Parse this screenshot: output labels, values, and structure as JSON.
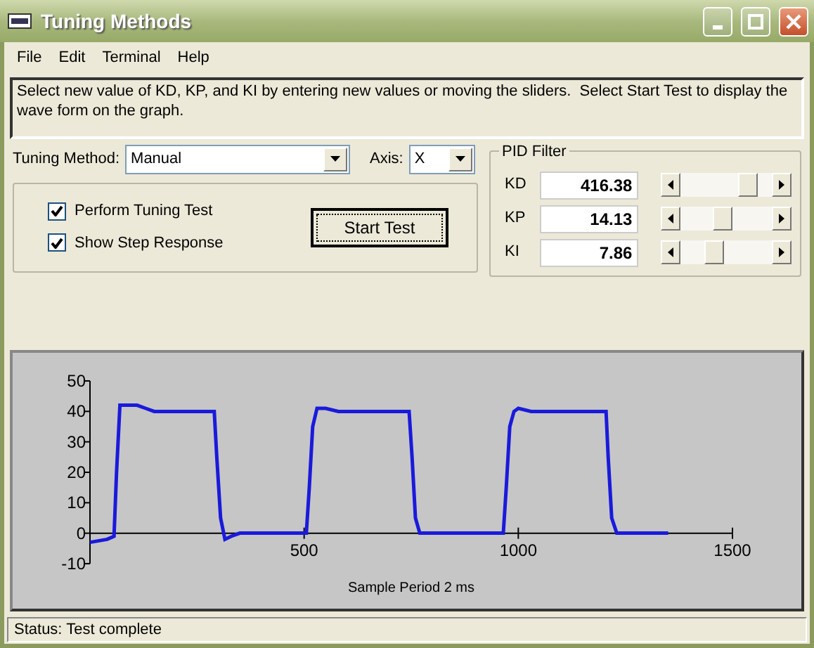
{
  "window": {
    "title": "Tuning Methods"
  },
  "menu": [
    {
      "label": "File"
    },
    {
      "label": "Edit"
    },
    {
      "label": "Terminal"
    },
    {
      "label": "Help"
    }
  ],
  "instructions": "Select new value of KD, KP, and KI by entering new values or moving the sliders.  Select Start Test to display the wave form on the graph.",
  "tuning_method": {
    "label": "Tuning Method:",
    "value": "Manual"
  },
  "axis": {
    "label": "Axis:",
    "value": "X"
  },
  "options": [
    {
      "label": "Perform Tuning Test",
      "checked": true
    },
    {
      "label": "Show Step Response",
      "checked": true
    }
  ],
  "start_button": "Start Test",
  "pid_filter": {
    "title": "PID Filter",
    "params": [
      {
        "label": "KD",
        "value": "416.38",
        "level": 0.8
      },
      {
        "label": "KP",
        "value": "14.13",
        "level": 0.45
      },
      {
        "label": "KI",
        "value": "7.86",
        "level": 0.34
      }
    ]
  },
  "graph": {
    "chart_data": {
      "type": "line",
      "xlabel": "Sample Period 2 ms",
      "xlim": [
        0,
        1500
      ],
      "ylim": [
        -10,
        50
      ],
      "xticks": [
        500,
        1000,
        1500
      ],
      "yticks": [
        -10,
        0,
        10,
        20,
        30,
        40,
        50
      ],
      "x": [
        0,
        40,
        56,
        62,
        70,
        90,
        110,
        130,
        150,
        200,
        240,
        290,
        296,
        305,
        315,
        330,
        350,
        400,
        450,
        505,
        512,
        520,
        530,
        550,
        580,
        600,
        650,
        700,
        745,
        752,
        760,
        770,
        800,
        850,
        900,
        965,
        972,
        980,
        990,
        1000,
        1030,
        1060,
        1100,
        1150,
        1205,
        1210,
        1218,
        1230,
        1260,
        1300,
        1350
      ],
      "series": [
        {
          "color": "#1a1adc",
          "values": [
            -3,
            -2,
            -1,
            20,
            42,
            42,
            42,
            41,
            40,
            40,
            40,
            40,
            25,
            5,
            -2,
            -1,
            0,
            0,
            0,
            0,
            15,
            35,
            41,
            41,
            40,
            40,
            40,
            40,
            40,
            25,
            5,
            0,
            0,
            0,
            0,
            0,
            15,
            35,
            40,
            41,
            40,
            40,
            40,
            40,
            40,
            25,
            5,
            0,
            0,
            0,
            0
          ]
        }
      ]
    }
  },
  "status": "Status: Test complete"
}
